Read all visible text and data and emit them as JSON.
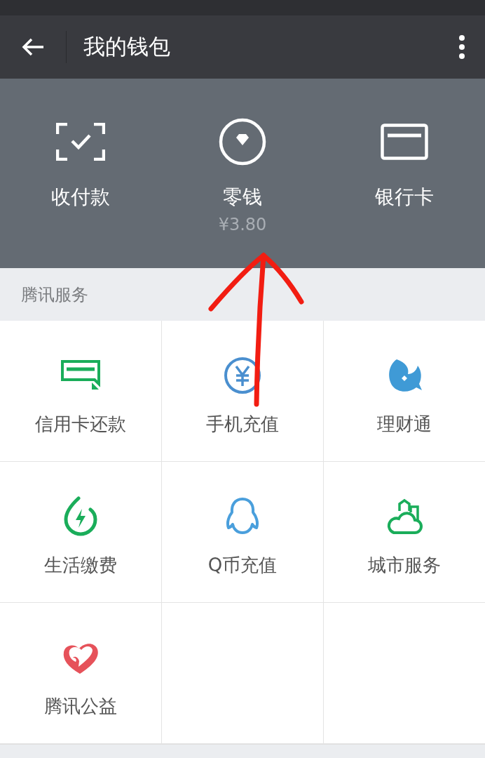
{
  "toolbar": {
    "title": "我的钱包"
  },
  "wallet_actions": [
    {
      "kind": "scan",
      "label": "收付款"
    },
    {
      "kind": "change",
      "label": "零钱",
      "amount": "¥3.80"
    },
    {
      "kind": "card",
      "label": "银行卡"
    }
  ],
  "section": {
    "title": "腾讯服务"
  },
  "services": [
    {
      "kind": "credit-card",
      "label": "信用卡还款",
      "color": "#1aad5a"
    },
    {
      "kind": "yuan",
      "label": "手机充值",
      "color": "#4a8fcf"
    },
    {
      "kind": "fish",
      "label": "理财通",
      "color": "#3f9ad6"
    },
    {
      "kind": "power",
      "label": "生活缴费",
      "color": "#1aad5a"
    },
    {
      "kind": "penguin",
      "label": "Q币充值",
      "color": "#4a9fdc"
    },
    {
      "kind": "city",
      "label": "城市服务",
      "color": "#1aad5a"
    },
    {
      "kind": "heart",
      "label": "腾讯公益",
      "color": "#e6525a"
    }
  ],
  "annotation": {
    "kind": "arrow"
  }
}
